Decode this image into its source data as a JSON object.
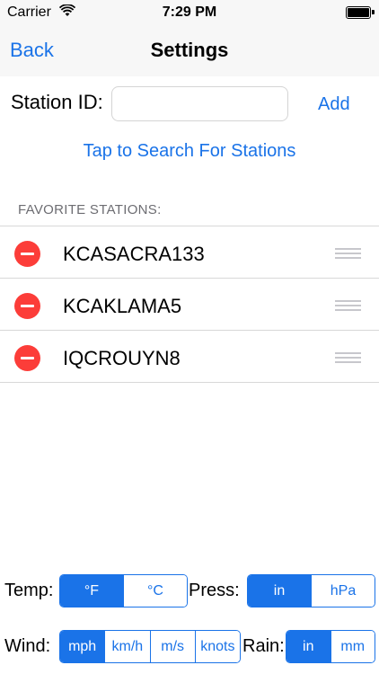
{
  "status_bar": {
    "carrier": "Carrier",
    "time": "7:29 PM"
  },
  "nav": {
    "back_label": "Back",
    "title": "Settings"
  },
  "station": {
    "label": "Station ID:",
    "input_value": "",
    "add_label": "Add"
  },
  "search_link": "Tap to Search For Stations",
  "favorites": {
    "header": "FAVORITE STATIONS:",
    "items": [
      {
        "name": "KCASACRA133"
      },
      {
        "name": "KCAKLAMA5"
      },
      {
        "name": "IQCROUYN8"
      }
    ]
  },
  "units": {
    "temp": {
      "label": "Temp:",
      "options": [
        "°F",
        "°C"
      ],
      "selected": "°F"
    },
    "press": {
      "label": "Press:",
      "options": [
        "in",
        "hPa"
      ],
      "selected": "in"
    },
    "wind": {
      "label": "Wind:",
      "options": [
        "mph",
        "km/h",
        "m/s",
        "knots"
      ],
      "selected": "mph"
    },
    "rain": {
      "label": "Rain:",
      "options": [
        "in",
        "mm"
      ],
      "selected": "in"
    }
  },
  "colors": {
    "accent": "#1a73e8",
    "delete": "#fc3d39",
    "bar_bg": "#f7f7f7"
  },
  "icons": {
    "wifi": "wifi-icon",
    "battery": "battery-icon",
    "delete": "minus-circle-icon",
    "reorder": "reorder-handle-icon"
  }
}
